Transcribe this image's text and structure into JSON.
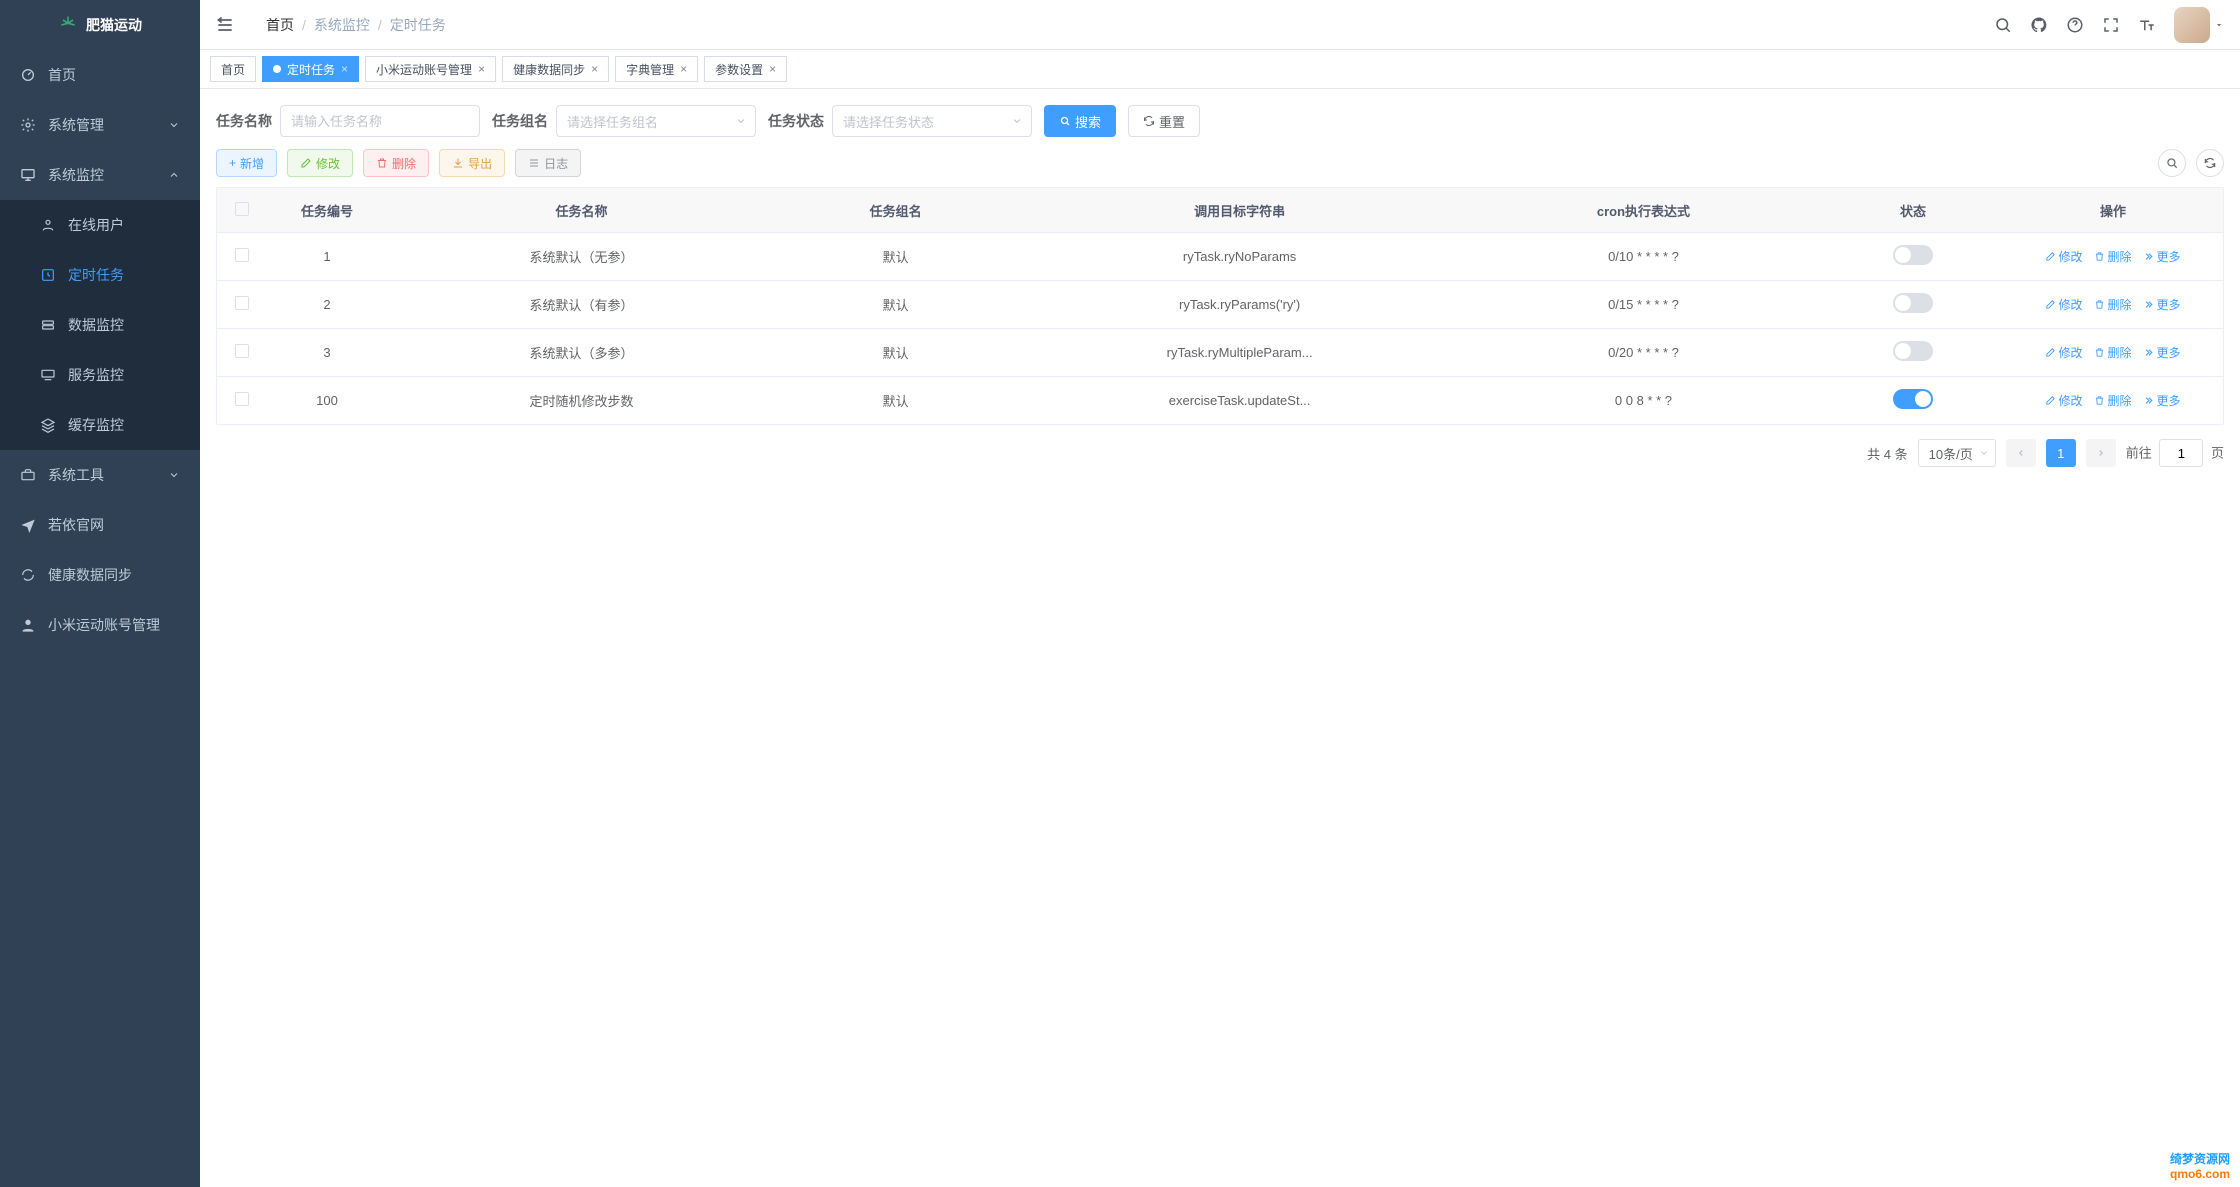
{
  "brand": "肥猫运动",
  "sidebar": {
    "home": "首页",
    "sys_manage": "系统管理",
    "sys_monitor": "系统监控",
    "submenu": {
      "online": "在线用户",
      "job": "定时任务",
      "data": "数据监控",
      "service": "服务监控",
      "cache": "缓存监控"
    },
    "sys_tool": "系统工具",
    "ruoyi": "若依官网",
    "health_sync": "健康数据同步",
    "xiaomi_acct": "小米运动账号管理"
  },
  "breadcrumb": {
    "home": "首页",
    "mid": "系统监控",
    "last": "定时任务"
  },
  "tabs": {
    "home": "首页",
    "job": "定时任务",
    "xiaomi": "小米运动账号管理",
    "health": "健康数据同步",
    "dict": "字典管理",
    "param": "参数设置"
  },
  "search": {
    "name_label": "任务名称",
    "name_placeholder": "请输入任务名称",
    "group_label": "任务组名",
    "group_placeholder": "请选择任务组名",
    "status_label": "任务状态",
    "status_placeholder": "请选择任务状态",
    "search_btn": "搜索",
    "reset_btn": "重置"
  },
  "toolbar": {
    "add": "新增",
    "edit": "修改",
    "delete": "删除",
    "export": "导出",
    "log": "日志"
  },
  "table": {
    "headers": {
      "id": "任务编号",
      "name": "任务名称",
      "group": "任务组名",
      "invoke": "调用目标字符串",
      "cron": "cron执行表达式",
      "status": "状态",
      "ops": "操作"
    },
    "rows": [
      {
        "id": "1",
        "name": "系统默认（无参）",
        "group": "默认",
        "invoke": "ryTask.ryNoParams",
        "cron": "0/10 * * * * ?",
        "on": false
      },
      {
        "id": "2",
        "name": "系统默认（有参）",
        "group": "默认",
        "invoke": "ryTask.ryParams('ry')",
        "cron": "0/15 * * * * ?",
        "on": false
      },
      {
        "id": "3",
        "name": "系统默认（多参）",
        "group": "默认",
        "invoke": "ryTask.ryMultipleParam...",
        "cron": "0/20 * * * * ?",
        "on": false
      },
      {
        "id": "100",
        "name": "定时随机修改步数",
        "group": "默认",
        "invoke": "exerciseTask.updateSt...",
        "cron": "0 0 8 * * ?",
        "on": true
      }
    ],
    "action_edit": "修改",
    "action_delete": "删除",
    "action_more": "更多"
  },
  "pagination": {
    "total_text": "共 4 条",
    "page_size": "10条/页",
    "goto_prefix": "前往",
    "goto_suffix": "页",
    "current": "1"
  },
  "watermark": {
    "line1": "绮梦资源网",
    "line2": "qmo6.com"
  }
}
